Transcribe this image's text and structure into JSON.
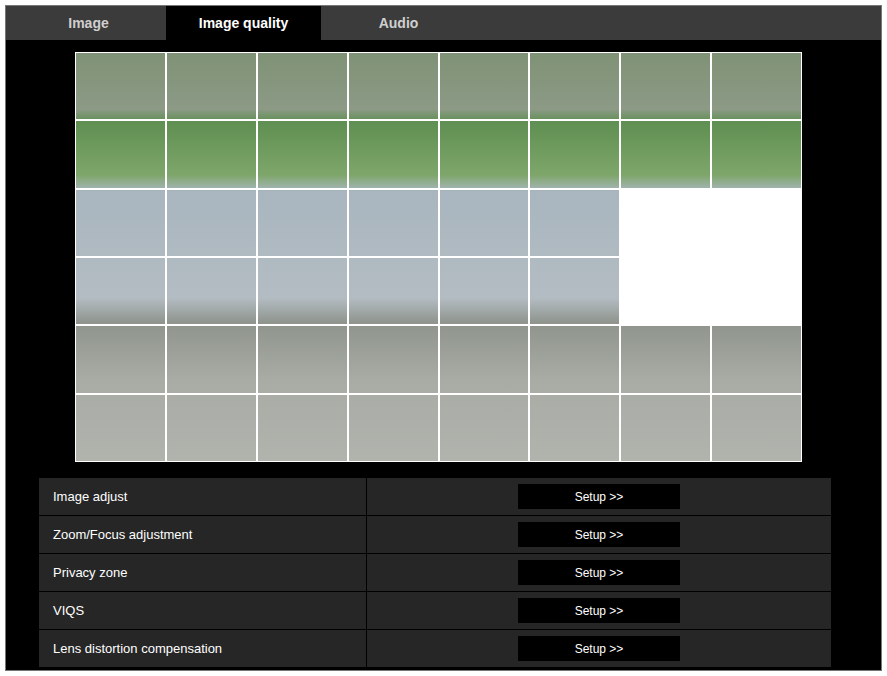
{
  "tabs": [
    {
      "label": "Image",
      "selected": false
    },
    {
      "label": "Image quality",
      "selected": true
    },
    {
      "label": "Audio",
      "selected": false
    }
  ],
  "privacy_grid": {
    "rows": [
      [
        false,
        false,
        false,
        false,
        false,
        false,
        false,
        false
      ],
      [
        false,
        false,
        false,
        false,
        false,
        false,
        false,
        false
      ],
      [
        false,
        false,
        false,
        false,
        false,
        false,
        true,
        true
      ],
      [
        false,
        false,
        false,
        false,
        false,
        false,
        true,
        true
      ],
      [
        false,
        false,
        false,
        false,
        false,
        false,
        false,
        false
      ],
      [
        false,
        false,
        false,
        false,
        false,
        false,
        false,
        false
      ]
    ]
  },
  "settings": [
    {
      "label": "Image adjust",
      "button": "Setup >>"
    },
    {
      "label": "Zoom/Focus adjustment",
      "button": "Setup >>"
    },
    {
      "label": "Privacy zone",
      "button": "Setup >>"
    },
    {
      "label": "VIQS",
      "button": "Setup >>"
    },
    {
      "label": "Lens distortion compensation",
      "button": "Setup >>"
    }
  ]
}
